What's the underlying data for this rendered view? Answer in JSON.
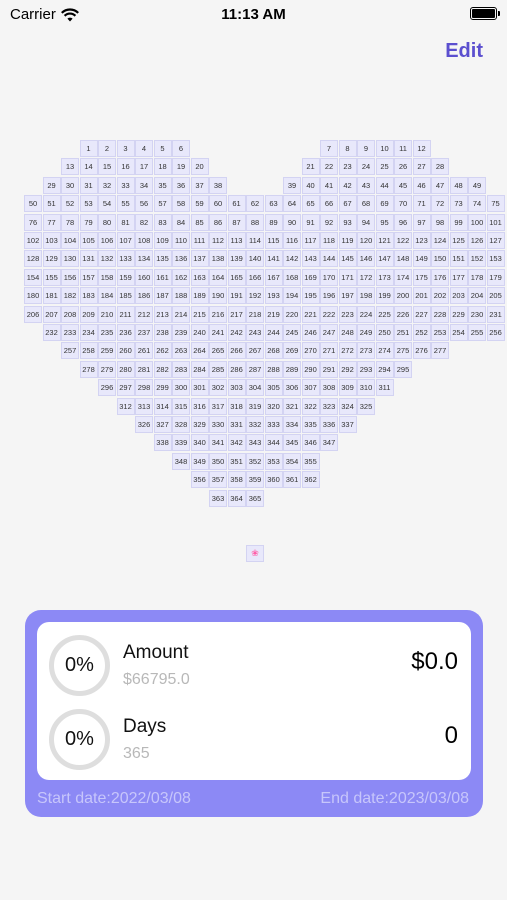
{
  "status_bar": {
    "carrier": "Carrier",
    "time": "11:13 AM"
  },
  "header": {
    "edit_label": "Edit"
  },
  "heart": {
    "count": 365,
    "marker": "❀"
  },
  "summary": {
    "amount": {
      "percent": "0%",
      "label": "Amount",
      "total": "$66795.0",
      "value": "$0.0"
    },
    "days": {
      "percent": "0%",
      "label": "Days",
      "total": "365",
      "value": "0"
    },
    "start_date": "Start date:2022/03/08",
    "end_date": "End date:2023/03/08"
  },
  "colors": {
    "accent": "#8c89f5",
    "edit": "#5b4fcf",
    "cell": "#e8e8fb"
  }
}
